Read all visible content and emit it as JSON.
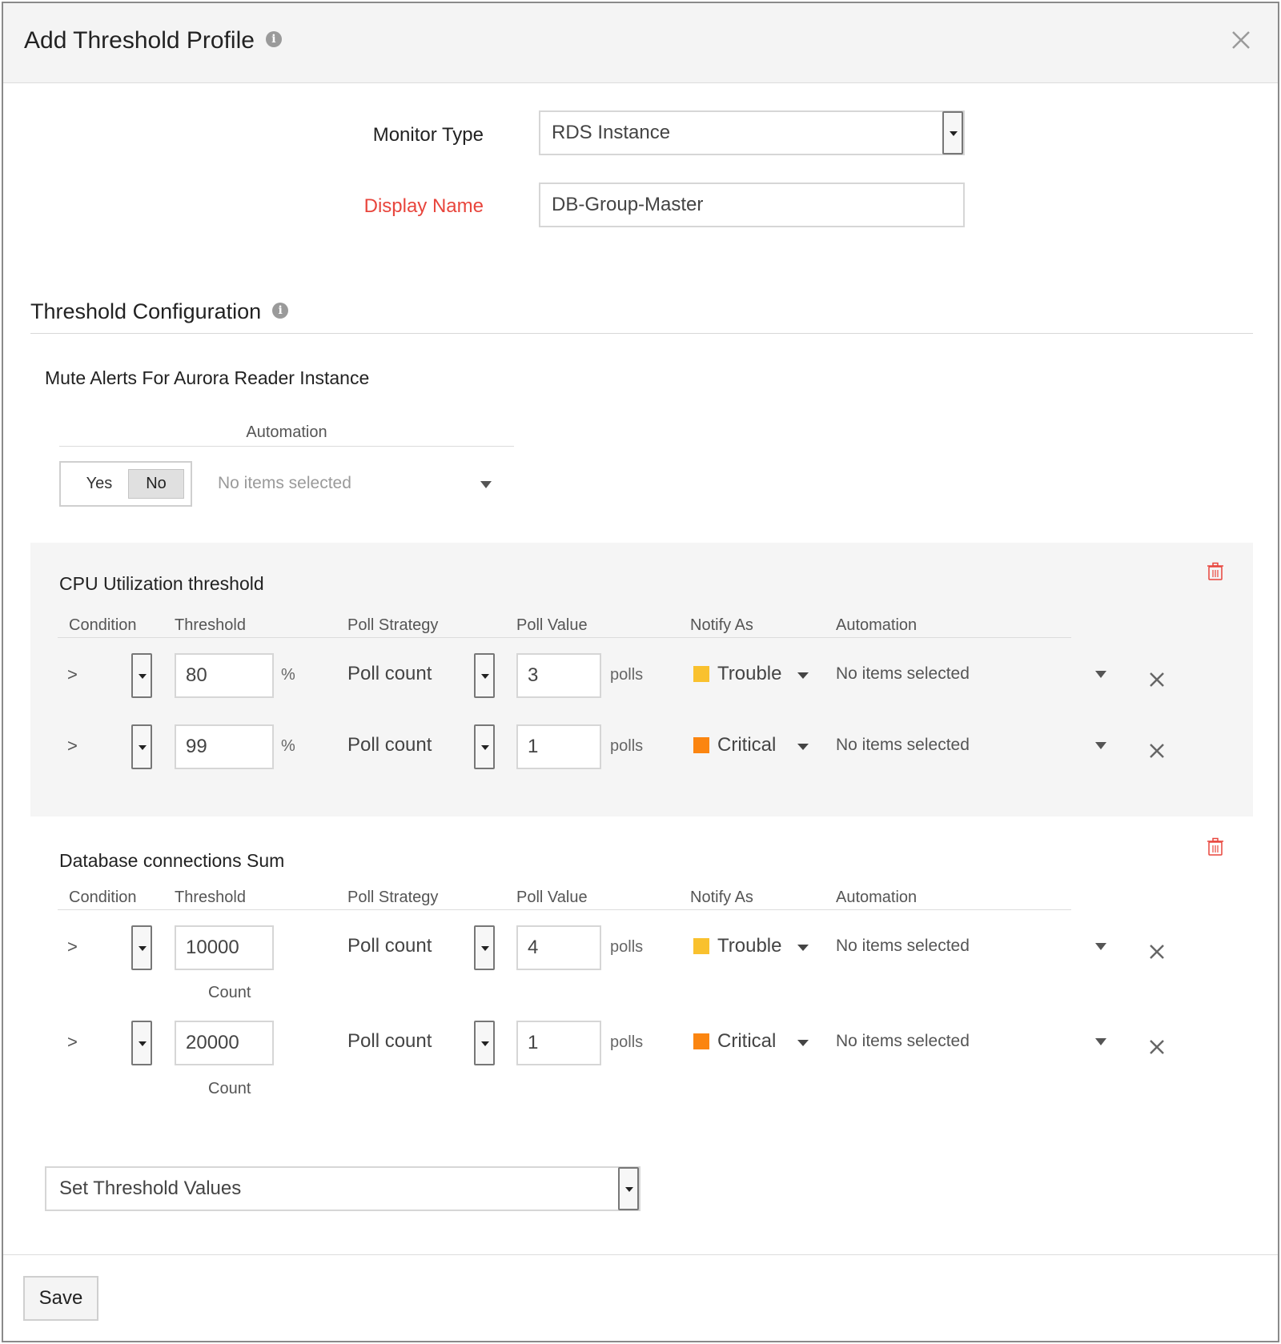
{
  "dialog": {
    "title": "Add Threshold Profile",
    "info_icon": "info-icon",
    "close_icon": "close-icon"
  },
  "form": {
    "monitor_type_label": "Monitor Type",
    "monitor_type_value": "RDS Instance",
    "display_name_label": "Display Name",
    "display_name_value": "DB-Group-Master"
  },
  "threshold_config": {
    "title": "Threshold Configuration",
    "mute_label": "Mute Alerts For Aurora Reader Instance",
    "automation_header": "Automation",
    "toggle_yes": "Yes",
    "toggle_no": "No",
    "toggle_selected": "No",
    "automation_placeholder": "No items selected"
  },
  "columns": {
    "condition": "Condition",
    "threshold": "Threshold",
    "poll_strategy": "Poll Strategy",
    "poll_value": "Poll Value",
    "notify_as": "Notify As",
    "automation": "Automation"
  },
  "panels": [
    {
      "title": "CPU Utilization threshold",
      "rows": [
        {
          "condition": ">",
          "threshold": "80",
          "unit": "%",
          "poll_strategy": "Poll count",
          "poll_value": "3",
          "poll_unit": "polls",
          "notify": "Trouble",
          "notify_color": "#f9c12e",
          "automation": "No items selected"
        },
        {
          "condition": ">",
          "threshold": "99",
          "unit": "%",
          "poll_strategy": "Poll count",
          "poll_value": "1",
          "poll_unit": "polls",
          "notify": "Critical",
          "notify_color": "#fb8510",
          "automation": "No items selected"
        }
      ]
    },
    {
      "title": "Database connections Sum",
      "rows": [
        {
          "condition": ">",
          "threshold": "10000",
          "unit": "Count",
          "poll_strategy": "Poll count",
          "poll_value": "4",
          "poll_unit": "polls",
          "notify": "Trouble",
          "notify_color": "#f9c12e",
          "automation": "No items selected"
        },
        {
          "condition": ">",
          "threshold": "20000",
          "unit": "Count",
          "poll_strategy": "Poll count",
          "poll_value": "1",
          "poll_unit": "polls",
          "notify": "Critical",
          "notify_color": "#fb8510",
          "automation": "No items selected"
        }
      ]
    }
  ],
  "set_threshold_select": "Set Threshold Values",
  "footer": {
    "save_label": "Save"
  },
  "colors": {
    "required_label": "#e8453c",
    "trash_icon": "#e8453c",
    "trouble": "#f9c12e",
    "critical": "#fb8510"
  }
}
